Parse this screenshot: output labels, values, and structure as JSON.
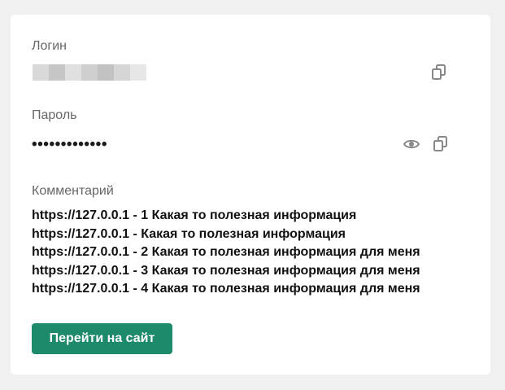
{
  "login": {
    "label": "Логин",
    "copy_icon": "copy-icon"
  },
  "password": {
    "label": "Пароль",
    "value": "•••••••••••••",
    "show_icon": "eye-icon",
    "copy_icon": "copy-icon"
  },
  "comment": {
    "label": "Комментарий",
    "lines": [
      "https://127.0.0.1 - 1 Какая то полезная информация",
      "https://127.0.0.1 - Какая то полезная информация",
      "https://127.0.0.1 - 2 Какая то полезная информация для меня",
      "https://127.0.0.1 - 3 Какая то полезная информация для меня",
      "https://127.0.0.1 - 4 Какая то полезная информация для меня"
    ]
  },
  "actions": {
    "go_label": "Перейти на сайт"
  },
  "colors": {
    "accent": "#1e8a6c",
    "background": "#f0f0f0",
    "card": "#ffffff",
    "label": "#666666",
    "icon": "#888888"
  }
}
